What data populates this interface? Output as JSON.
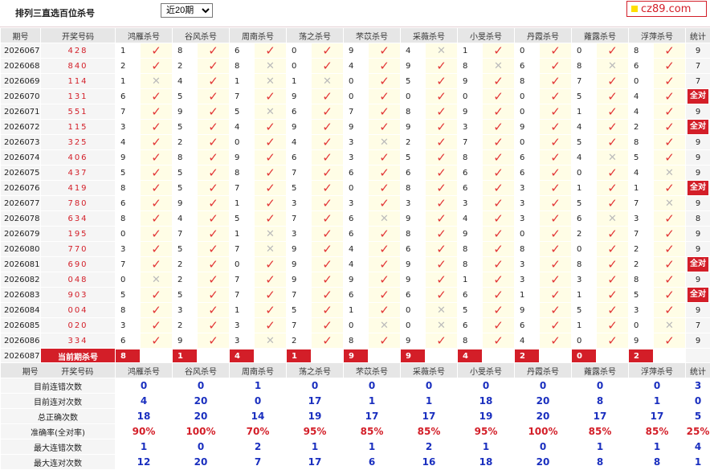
{
  "header": {
    "title": "排列三直选百位杀号",
    "period_selected": "近20期",
    "brand": "cz89.com"
  },
  "colors": {
    "accent": "#d31e28",
    "check": "#e23636",
    "stats_blue": "#1a2fbf"
  },
  "columns": {
    "issue": "期号",
    "draw": "开奖号码",
    "total": "统计",
    "kills": [
      "鸿雁杀号",
      "谷风杀号",
      "周南杀号",
      "荡之杀号",
      "芣苡杀号",
      "采薇杀号",
      "小旻杀号",
      "丹霞杀号",
      "蕹露杀号",
      "浮萍杀号"
    ]
  },
  "rows": [
    {
      "issue": "2026067",
      "draw": "428",
      "cells": [
        [
          "1",
          "v"
        ],
        [
          "8",
          "v"
        ],
        [
          "6",
          "v"
        ],
        [
          "0",
          "v"
        ],
        [
          "9",
          "v"
        ],
        [
          "4",
          "x"
        ],
        [
          "1",
          "v"
        ],
        [
          "0",
          "v"
        ],
        [
          "0",
          "v"
        ],
        [
          "8",
          "v"
        ]
      ],
      "total": "9"
    },
    {
      "issue": "2026068",
      "draw": "840",
      "cells": [
        [
          "2",
          "v"
        ],
        [
          "2",
          "v"
        ],
        [
          "8",
          "x"
        ],
        [
          "0",
          "v"
        ],
        [
          "4",
          "v"
        ],
        [
          "9",
          "v"
        ],
        [
          "8",
          "x"
        ],
        [
          "6",
          "v"
        ],
        [
          "8",
          "x"
        ],
        [
          "6",
          "v"
        ]
      ],
      "total": "7"
    },
    {
      "issue": "2026069",
      "draw": "114",
      "cells": [
        [
          "1",
          "x"
        ],
        [
          "4",
          "v"
        ],
        [
          "1",
          "x"
        ],
        [
          "1",
          "x"
        ],
        [
          "0",
          "v"
        ],
        [
          "5",
          "v"
        ],
        [
          "9",
          "v"
        ],
        [
          "8",
          "v"
        ],
        [
          "7",
          "v"
        ],
        [
          "0",
          "v"
        ]
      ],
      "total": "7"
    },
    {
      "issue": "2026070",
      "draw": "131",
      "cells": [
        [
          "6",
          "v"
        ],
        [
          "5",
          "v"
        ],
        [
          "7",
          "v"
        ],
        [
          "9",
          "v"
        ],
        [
          "0",
          "v"
        ],
        [
          "0",
          "v"
        ],
        [
          "0",
          "v"
        ],
        [
          "0",
          "v"
        ],
        [
          "5",
          "v"
        ],
        [
          "4",
          "v"
        ]
      ],
      "total": "全对"
    },
    {
      "issue": "2026071",
      "draw": "551",
      "cells": [
        [
          "7",
          "v"
        ],
        [
          "9",
          "v"
        ],
        [
          "5",
          "x"
        ],
        [
          "6",
          "v"
        ],
        [
          "7",
          "v"
        ],
        [
          "8",
          "v"
        ],
        [
          "9",
          "v"
        ],
        [
          "0",
          "v"
        ],
        [
          "1",
          "v"
        ],
        [
          "4",
          "v"
        ]
      ],
      "total": "9"
    },
    {
      "issue": "2026072",
      "draw": "115",
      "cells": [
        [
          "3",
          "v"
        ],
        [
          "5",
          "v"
        ],
        [
          "4",
          "v"
        ],
        [
          "9",
          "v"
        ],
        [
          "9",
          "v"
        ],
        [
          "9",
          "v"
        ],
        [
          "3",
          "v"
        ],
        [
          "9",
          "v"
        ],
        [
          "4",
          "v"
        ],
        [
          "2",
          "v"
        ]
      ],
      "total": "全对"
    },
    {
      "issue": "2026073",
      "draw": "325",
      "cells": [
        [
          "4",
          "v"
        ],
        [
          "2",
          "v"
        ],
        [
          "0",
          "v"
        ],
        [
          "4",
          "v"
        ],
        [
          "3",
          "x"
        ],
        [
          "2",
          "v"
        ],
        [
          "7",
          "v"
        ],
        [
          "0",
          "v"
        ],
        [
          "5",
          "v"
        ],
        [
          "8",
          "v"
        ]
      ],
      "total": "9"
    },
    {
      "issue": "2026074",
      "draw": "406",
      "cells": [
        [
          "9",
          "v"
        ],
        [
          "8",
          "v"
        ],
        [
          "9",
          "v"
        ],
        [
          "6",
          "v"
        ],
        [
          "3",
          "v"
        ],
        [
          "5",
          "v"
        ],
        [
          "8",
          "v"
        ],
        [
          "6",
          "v"
        ],
        [
          "4",
          "x"
        ],
        [
          "5",
          "v"
        ]
      ],
      "total": "9"
    },
    {
      "issue": "2026075",
      "draw": "437",
      "cells": [
        [
          "5",
          "v"
        ],
        [
          "5",
          "v"
        ],
        [
          "8",
          "v"
        ],
        [
          "7",
          "v"
        ],
        [
          "6",
          "v"
        ],
        [
          "6",
          "v"
        ],
        [
          "6",
          "v"
        ],
        [
          "6",
          "v"
        ],
        [
          "0",
          "v"
        ],
        [
          "4",
          "x"
        ]
      ],
      "total": "9"
    },
    {
      "issue": "2026076",
      "draw": "419",
      "cells": [
        [
          "8",
          "v"
        ],
        [
          "5",
          "v"
        ],
        [
          "7",
          "v"
        ],
        [
          "5",
          "v"
        ],
        [
          "0",
          "v"
        ],
        [
          "8",
          "v"
        ],
        [
          "6",
          "v"
        ],
        [
          "3",
          "v"
        ],
        [
          "1",
          "v"
        ],
        [
          "1",
          "v"
        ]
      ],
      "total": "全对"
    },
    {
      "issue": "2026077",
      "draw": "780",
      "cells": [
        [
          "6",
          "v"
        ],
        [
          "9",
          "v"
        ],
        [
          "1",
          "v"
        ],
        [
          "3",
          "v"
        ],
        [
          "3",
          "v"
        ],
        [
          "3",
          "v"
        ],
        [
          "3",
          "v"
        ],
        [
          "3",
          "v"
        ],
        [
          "5",
          "v"
        ],
        [
          "7",
          "x"
        ]
      ],
      "total": "9"
    },
    {
      "issue": "2026078",
      "draw": "634",
      "cells": [
        [
          "8",
          "v"
        ],
        [
          "4",
          "v"
        ],
        [
          "5",
          "v"
        ],
        [
          "7",
          "v"
        ],
        [
          "6",
          "x"
        ],
        [
          "9",
          "v"
        ],
        [
          "4",
          "v"
        ],
        [
          "3",
          "v"
        ],
        [
          "6",
          "x"
        ],
        [
          "3",
          "v"
        ]
      ],
      "total": "8"
    },
    {
      "issue": "2026079",
      "draw": "195",
      "cells": [
        [
          "0",
          "v"
        ],
        [
          "7",
          "v"
        ],
        [
          "1",
          "x"
        ],
        [
          "3",
          "v"
        ],
        [
          "6",
          "v"
        ],
        [
          "8",
          "v"
        ],
        [
          "9",
          "v"
        ],
        [
          "0",
          "v"
        ],
        [
          "2",
          "v"
        ],
        [
          "7",
          "v"
        ]
      ],
      "total": "9"
    },
    {
      "issue": "2026080",
      "draw": "770",
      "cells": [
        [
          "3",
          "v"
        ],
        [
          "5",
          "v"
        ],
        [
          "7",
          "x"
        ],
        [
          "9",
          "v"
        ],
        [
          "4",
          "v"
        ],
        [
          "6",
          "v"
        ],
        [
          "8",
          "v"
        ],
        [
          "8",
          "v"
        ],
        [
          "0",
          "v"
        ],
        [
          "2",
          "v"
        ]
      ],
      "total": "9"
    },
    {
      "issue": "2026081",
      "draw": "690",
      "cells": [
        [
          "7",
          "v"
        ],
        [
          "2",
          "v"
        ],
        [
          "0",
          "v"
        ],
        [
          "9",
          "v"
        ],
        [
          "4",
          "v"
        ],
        [
          "9",
          "v"
        ],
        [
          "8",
          "v"
        ],
        [
          "3",
          "v"
        ],
        [
          "8",
          "v"
        ],
        [
          "2",
          "v"
        ]
      ],
      "total": "全对"
    },
    {
      "issue": "2026082",
      "draw": "048",
      "cells": [
        [
          "0",
          "x"
        ],
        [
          "2",
          "v"
        ],
        [
          "7",
          "v"
        ],
        [
          "9",
          "v"
        ],
        [
          "9",
          "v"
        ],
        [
          "9",
          "v"
        ],
        [
          "1",
          "v"
        ],
        [
          "3",
          "v"
        ],
        [
          "3",
          "v"
        ],
        [
          "8",
          "v"
        ]
      ],
      "total": "9"
    },
    {
      "issue": "2026083",
      "draw": "903",
      "cells": [
        [
          "5",
          "v"
        ],
        [
          "5",
          "v"
        ],
        [
          "7",
          "v"
        ],
        [
          "7",
          "v"
        ],
        [
          "6",
          "v"
        ],
        [
          "6",
          "v"
        ],
        [
          "6",
          "v"
        ],
        [
          "1",
          "v"
        ],
        [
          "1",
          "v"
        ],
        [
          "5",
          "v"
        ]
      ],
      "total": "全对"
    },
    {
      "issue": "2026084",
      "draw": "004",
      "cells": [
        [
          "8",
          "v"
        ],
        [
          "3",
          "v"
        ],
        [
          "1",
          "v"
        ],
        [
          "5",
          "v"
        ],
        [
          "1",
          "v"
        ],
        [
          "0",
          "x"
        ],
        [
          "5",
          "v"
        ],
        [
          "9",
          "v"
        ],
        [
          "5",
          "v"
        ],
        [
          "3",
          "v"
        ]
      ],
      "total": "9"
    },
    {
      "issue": "2026085",
      "draw": "020",
      "cells": [
        [
          "3",
          "v"
        ],
        [
          "2",
          "v"
        ],
        [
          "3",
          "v"
        ],
        [
          "7",
          "v"
        ],
        [
          "0",
          "x"
        ],
        [
          "0",
          "x"
        ],
        [
          "6",
          "v"
        ],
        [
          "6",
          "v"
        ],
        [
          "1",
          "v"
        ],
        [
          "0",
          "x"
        ]
      ],
      "total": "7"
    },
    {
      "issue": "2026086",
      "draw": "334",
      "cells": [
        [
          "6",
          "v"
        ],
        [
          "9",
          "v"
        ],
        [
          "3",
          "x"
        ],
        [
          "2",
          "v"
        ],
        [
          "8",
          "v"
        ],
        [
          "9",
          "v"
        ],
        [
          "8",
          "v"
        ],
        [
          "4",
          "v"
        ],
        [
          "0",
          "v"
        ],
        [
          "9",
          "v"
        ]
      ],
      "total": "9"
    }
  ],
  "current": {
    "issue": "2026087",
    "label": "当前期杀号",
    "kills": [
      "8",
      "1",
      "4",
      "1",
      "9",
      "9",
      "4",
      "2",
      "0",
      "2"
    ]
  },
  "stats": [
    {
      "label": "目前连错次数",
      "values": [
        "0",
        "0",
        "1",
        "0",
        "0",
        "0",
        "0",
        "0",
        "0",
        "0",
        "3"
      ]
    },
    {
      "label": "目前连对次数",
      "values": [
        "4",
        "20",
        "0",
        "17",
        "1",
        "1",
        "18",
        "20",
        "8",
        "1",
        "0"
      ]
    },
    {
      "label": "总正确次数",
      "values": [
        "18",
        "20",
        "14",
        "19",
        "17",
        "17",
        "19",
        "20",
        "17",
        "17",
        "5"
      ]
    },
    {
      "label": "准确率(全对率)",
      "values": [
        "90%",
        "100%",
        "70%",
        "95%",
        "85%",
        "85%",
        "95%",
        "100%",
        "85%",
        "85%",
        "25%"
      ],
      "pct": true
    },
    {
      "label": "最大连错次数",
      "values": [
        "1",
        "0",
        "2",
        "1",
        "1",
        "2",
        "1",
        "0",
        "1",
        "1",
        "4"
      ]
    },
    {
      "label": "最大连对次数",
      "values": [
        "12",
        "20",
        "7",
        "17",
        "6",
        "16",
        "18",
        "20",
        "8",
        "8",
        "1"
      ]
    }
  ]
}
